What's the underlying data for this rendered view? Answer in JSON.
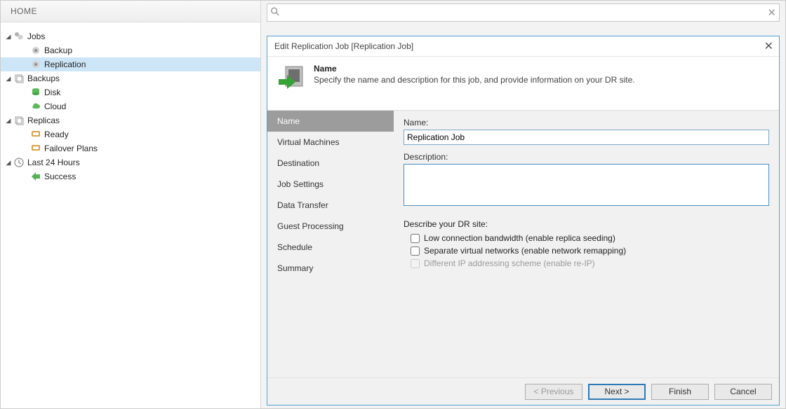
{
  "sidebar": {
    "title": "HOME",
    "tree": {
      "jobs": "Jobs",
      "backup": "Backup",
      "replication": "Replication",
      "backups": "Backups",
      "disk": "Disk",
      "cloud": "Cloud",
      "replicas": "Replicas",
      "ready": "Ready",
      "failover": "Failover Plans",
      "last24": "Last 24 Hours",
      "success": "Success"
    }
  },
  "search": {
    "placeholder": ""
  },
  "dialog": {
    "title": "Edit Replication Job [Replication Job]",
    "banner_title": "Name",
    "banner_desc": "Specify the name and description for this job, and provide information on your DR site.",
    "steps": {
      "name": "Name",
      "vms": "Virtual Machines",
      "dest": "Destination",
      "jobset": "Job Settings",
      "data": "Data Transfer",
      "guest": "Guest Processing",
      "sched": "Schedule",
      "summary": "Summary"
    },
    "fields": {
      "name_label": "Name:",
      "name_value": "Replication Job",
      "desc_label": "Description:",
      "desc_value": "",
      "dr_section": "Describe your DR site:",
      "seed": "Low connection bandwidth (enable replica seeding)",
      "netmap": "Separate virtual networks (enable network remapping)",
      "reip": "Different IP addressing scheme (enable re-IP)"
    },
    "buttons": {
      "prev": "< Previous",
      "next": "Next >",
      "finish": "Finish",
      "cancel": "Cancel"
    }
  }
}
